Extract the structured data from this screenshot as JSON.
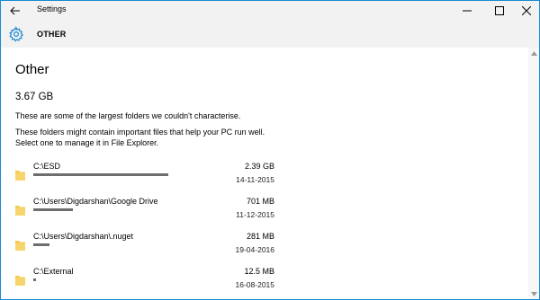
{
  "window": {
    "title": "Settings",
    "accent": "#1a8ad4"
  },
  "header": {
    "title": "OTHER",
    "icon": "gear-icon"
  },
  "page": {
    "title": "Other",
    "total_size": "3.67 GB",
    "description_1": "These are some of the largest folders we couldn't characterise.",
    "description_2": "These folders might contain important files that help your PC run well. Select one to manage it in File Explorer."
  },
  "folders": [
    {
      "path": "C:\\ESD",
      "size": "2.39 GB",
      "date": "14-11-2015",
      "fraction": 1.0
    },
    {
      "path": "C:\\Users\\Digdarshan\\Google Drive",
      "size": "701 MB",
      "date": "11-12-2015",
      "fraction": 0.29
    },
    {
      "path": "C:\\Users\\Digdarshan\\.nuget",
      "size": "281 MB",
      "date": "19-04-2016",
      "fraction": 0.12
    },
    {
      "path": "C:\\External",
      "size": "12.5 MB",
      "date": "16-08-2015",
      "fraction": 0.02
    }
  ]
}
